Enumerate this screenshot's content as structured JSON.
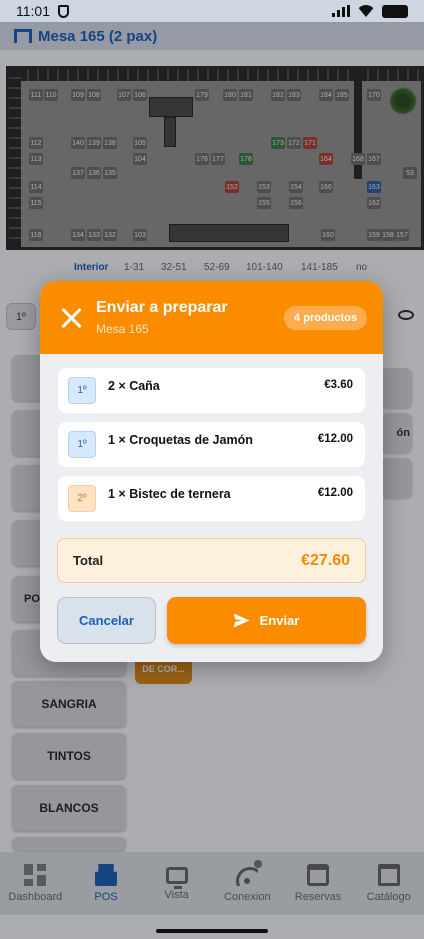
{
  "status_bar": {
    "time": "11:01"
  },
  "app_bar": {
    "title": "Mesa 165 (2 pax)"
  },
  "floor_plan": {
    "tables": [
      "111",
      "110",
      "109",
      "108",
      "107",
      "106",
      "179",
      "180",
      "181",
      "182",
      "183",
      "184",
      "185",
      "170",
      "112",
      "113",
      "140",
      "139",
      "138",
      "105",
      "104",
      "176",
      "177",
      "178",
      "173",
      "172",
      "171",
      "164",
      "168",
      "167",
      "114",
      "115",
      "137",
      "136",
      "135",
      "152",
      "153",
      "154",
      "155",
      "156",
      "166",
      "163",
      "162",
      "116",
      "134",
      "133",
      "132",
      "103",
      "160",
      "159",
      "158",
      "157",
      "53"
    ],
    "zones": [
      "Interior",
      "1-31",
      "32-51",
      "52-69",
      "101-140",
      "141-185",
      "no"
    ]
  },
  "background": {
    "seat_selector": "1º",
    "categories": [
      "PO",
      "SANGRIA",
      "TINTOS",
      "BLANCOS"
    ],
    "side_cards": [
      "ón"
    ],
    "chip": "DE COR..."
  },
  "dialog": {
    "title": "Enviar a preparar",
    "subtitle": "Mesa 165",
    "count_badge": "4 productos",
    "items": [
      {
        "course": "1º",
        "name": "2 × Caña",
        "price": "€3.60"
      },
      {
        "course": "1º",
        "name": "1 × Croquetas de Jamón",
        "price": "€12.00"
      },
      {
        "course": "2º",
        "name": "1 × Bistec de ternera",
        "price": "€12.00"
      }
    ],
    "total_label": "Total",
    "total_value": "€27.60",
    "cancel_label": "Cancelar",
    "send_label": "Enviar"
  },
  "nav": {
    "items": [
      {
        "label": "Dashboard",
        "icon": "dashboard-icon"
      },
      {
        "label": "POS",
        "icon": "cash-register-icon"
      },
      {
        "label": "Vista",
        "icon": "monitor-icon"
      },
      {
        "label": "Conexion",
        "icon": "wifi-icon"
      },
      {
        "label": "Reservas",
        "icon": "calendar-icon"
      },
      {
        "label": "Catálogo",
        "icon": "archive-icon"
      }
    ]
  },
  "colors": {
    "accent": "#fb8c00",
    "primary": "#1f5fb5",
    "total_bg": "#fdf0dc"
  }
}
